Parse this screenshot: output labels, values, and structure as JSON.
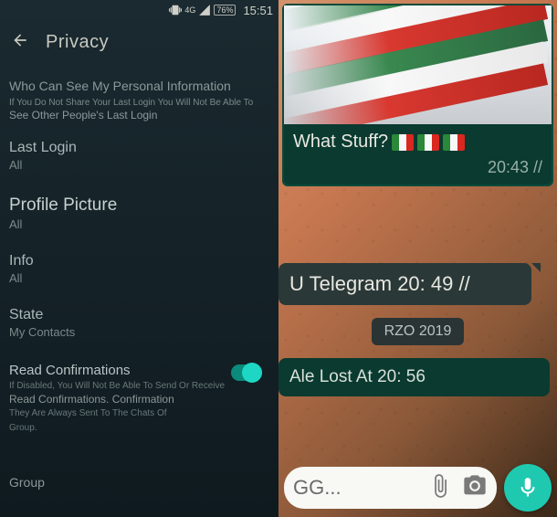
{
  "status": {
    "network": "4G",
    "battery": "76%",
    "time": "15:51"
  },
  "header": {
    "title": "Privacy"
  },
  "settings": {
    "personal_info_header": "Who Can See My Personal Information",
    "personal_info_note_1": "If You Do Not Share Your Last Login You Will Not Be Able To",
    "personal_info_note_2": "See Other People's Last Login",
    "last_login": {
      "label": "Last Login",
      "value": "All"
    },
    "profile_picture": {
      "label": "Profile Picture",
      "value": "All"
    },
    "info": {
      "label": "Info",
      "value": "All"
    },
    "state": {
      "label": "State",
      "value": "My Contacts"
    },
    "read_confirmations": {
      "label": "Read Confirmations",
      "desc_1": "If Disabled, You Will Not Be Able To Send Or Receive",
      "desc_2": "Read Confirmations. Confirmation",
      "desc_3": "They Are Always Sent To The Chats Of",
      "desc_4": "Group."
    },
    "group": {
      "label": "Group"
    }
  },
  "chat": {
    "msg1_text": "What Stuff?",
    "msg1_time": "20:43 //",
    "msg2_text": "U Telegram 20: 49 //",
    "date_badge": "RZO 2019",
    "msg3_text": "Ale Lost At 20: 56",
    "input_placeholder": "GG..."
  }
}
